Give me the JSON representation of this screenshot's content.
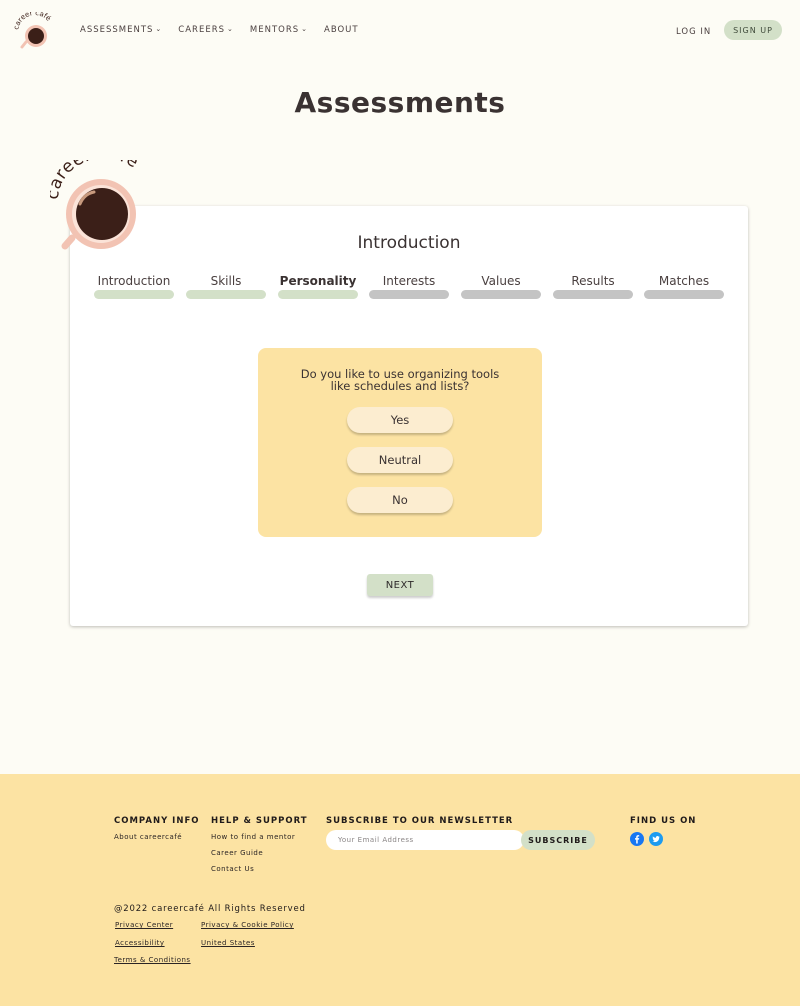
{
  "header": {
    "nav": [
      {
        "label": "ASSESSMENTS"
      },
      {
        "label": "CAREERS"
      },
      {
        "label": "MENTORS"
      },
      {
        "label": "ABOUT"
      }
    ],
    "login": "LOG IN",
    "signup": "SIGN UP"
  },
  "page_title": "Assessments",
  "logo_text": "career café",
  "card": {
    "title": "Introduction",
    "steps": [
      {
        "label": "Introduction",
        "state": "complete"
      },
      {
        "label": "Skills",
        "state": "complete"
      },
      {
        "label": "Personality",
        "state": "current"
      },
      {
        "label": "Interests",
        "state": "pending"
      },
      {
        "label": "Values",
        "state": "pending"
      },
      {
        "label": "Results",
        "state": "pending"
      },
      {
        "label": "Matches",
        "state": "pending"
      }
    ],
    "question": {
      "line1": "Do you like to use organizing tools",
      "line2": "like schedules and lists?",
      "answers": [
        "Yes",
        "Neutral",
        "No"
      ]
    },
    "next": "NEXT"
  },
  "footer": {
    "company": {
      "heading": "COMPANY INFO",
      "links": [
        "About careercafé"
      ]
    },
    "help": {
      "heading": "HELP & SUPPORT",
      "links": [
        "How to find a mentor",
        "Career Guide",
        "Contact Us"
      ]
    },
    "newsletter": {
      "heading": "SUBSCRIBE TO OUR NEWSLETTER",
      "placeholder": "Your Email Address",
      "button": "SUBSCRIBE"
    },
    "social": {
      "heading": "FIND US ON",
      "icons": [
        "facebook-icon",
        "twitter-icon"
      ]
    },
    "copyright": "@2022 careercafé All Rights Reserved",
    "legal": [
      "Privacy Center",
      "Privacy & Cookie Policy",
      "Accessibility",
      "United States",
      "Terms & Conditions"
    ]
  },
  "colors": {
    "background": "#fdfcf5",
    "accent_green": "#d3e0c8",
    "accent_yellow": "#fce3a3",
    "pending_gray": "#c4c4c4",
    "cup_pink": "#f2c3b3",
    "coffee": "#3b1f18"
  }
}
